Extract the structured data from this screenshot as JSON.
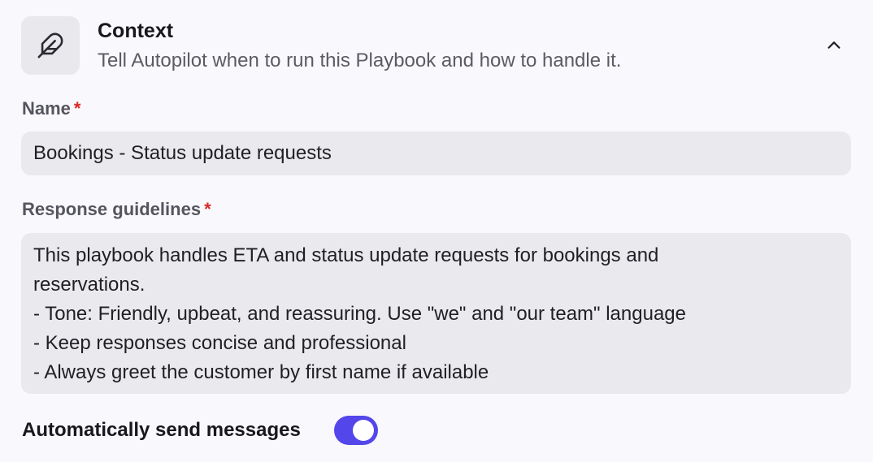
{
  "header": {
    "icon": "feather-icon",
    "title": "Context",
    "subtitle": "Tell Autopilot when to run this Playbook and how to handle it.",
    "collapse_icon": "chevron-up-icon"
  },
  "name_field": {
    "label": "Name",
    "required_marker": "*",
    "value": "Bookings - Status update requests"
  },
  "guidelines_field": {
    "label": "Response guidelines",
    "required_marker": "*",
    "lines": [
      "This playbook handles ETA and status update requests for bookings and",
      "reservations.",
      "- Tone: Friendly, upbeat, and reassuring. Use \"we\" and \"our team\" language",
      "- Keep responses concise and professional",
      "- Always greet the customer by first name if available"
    ]
  },
  "auto_send": {
    "label": "Automatically send messages",
    "enabled": true
  },
  "colors": {
    "accent": "#5346ea",
    "required": "#d92626",
    "field_bg": "#eae9ee",
    "page_bg": "#f9f8fc"
  }
}
